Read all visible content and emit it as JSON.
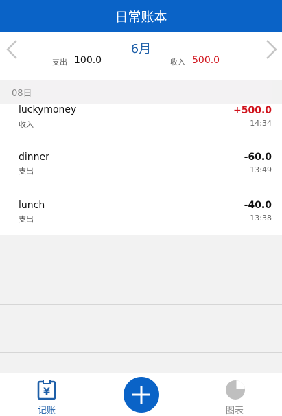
{
  "header": {
    "title": "日常账本"
  },
  "summary": {
    "month": "6月",
    "expense_label": "支出",
    "expense_value": "100.0",
    "income_label": "收入",
    "income_value": "500.0"
  },
  "list": {
    "date_header": "08日",
    "entries": [
      {
        "name": "luckymoney",
        "kind": "收入",
        "amount": "+500.0",
        "time": "14:34"
      },
      {
        "name": "dinner",
        "kind": "支出",
        "amount": "-60.0",
        "time": "13:49"
      },
      {
        "name": "lunch",
        "kind": "支出",
        "amount": "-40.0",
        "time": "13:38"
      }
    ]
  },
  "tabbar": {
    "ledger_label": "记账",
    "chart_label": "图表"
  },
  "colors": {
    "brand_blue": "#0a63c7",
    "income_red": "#d0121b"
  },
  "icons": [
    "chevron-left-icon",
    "chevron-right-icon",
    "ledger-icon",
    "add-icon",
    "pie-chart-icon"
  ]
}
